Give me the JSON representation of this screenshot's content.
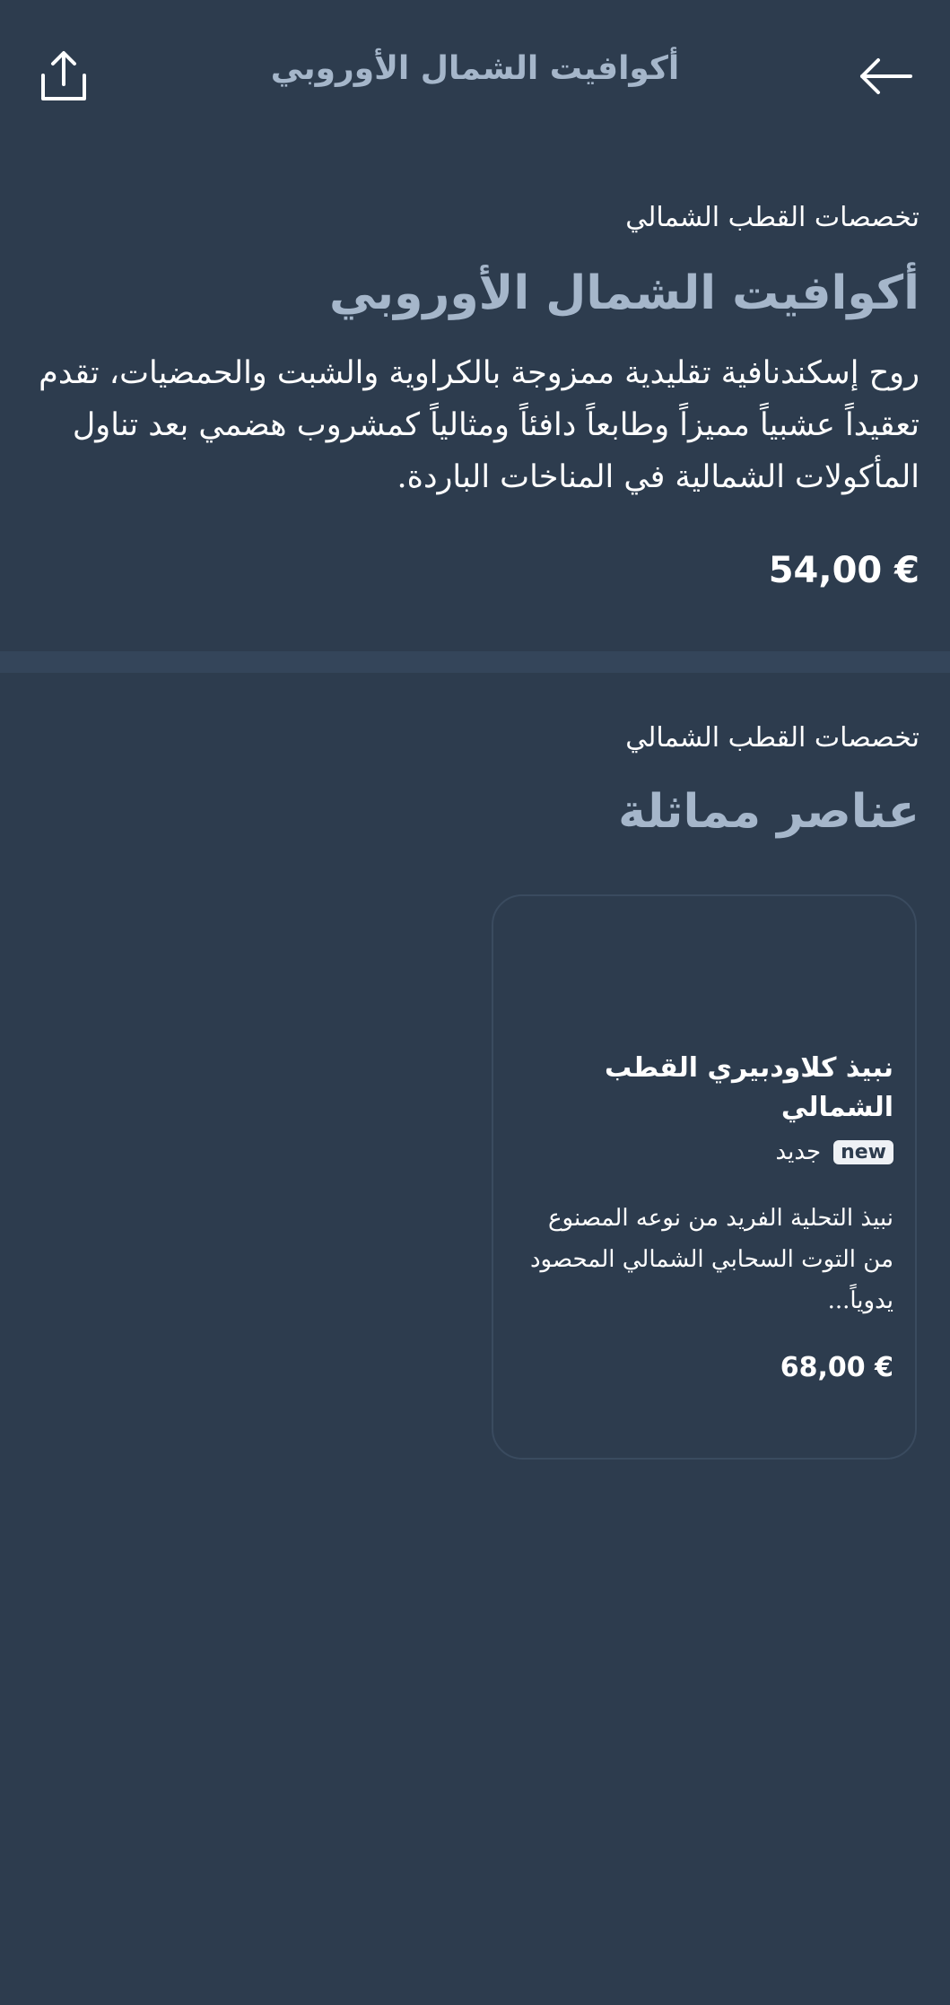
{
  "header": {
    "title": "أكوافيت الشمال الأوروبي",
    "share_icon": "share-icon",
    "back_icon": "arrow-back-icon"
  },
  "product": {
    "category": "تخصصات القطب الشمالي",
    "title": "أكوافيت الشمال الأوروبي",
    "description": "روح إسكندنافية تقليدية ممزوجة بالكراوية والشبت والحمضيات، تقدم تعقيداً عشبياً مميزاً وطابعاً دافئاً ومثالياً كمشروب هضمي بعد تناول المأكولات الشمالية في المناخات الباردة.",
    "price": "54,00 €"
  },
  "similar": {
    "category": "تخصصات القطب الشمالي",
    "title": "عناصر مماثلة",
    "items": [
      {
        "name": "نبيذ كلاودبيري القطب الشمالي",
        "badge": "new",
        "badge_text": "جديد",
        "description": "نبيذ التحلية الفريد من نوعه المصنوع من التوت السحابي الشمالي المحصود يدوياً...",
        "price": "68,00 €"
      }
    ]
  },
  "colors": {
    "background": "#2d3c4e",
    "divider": "#34455a",
    "title_accent": "#a5b6ca",
    "text": "#ffffff"
  }
}
